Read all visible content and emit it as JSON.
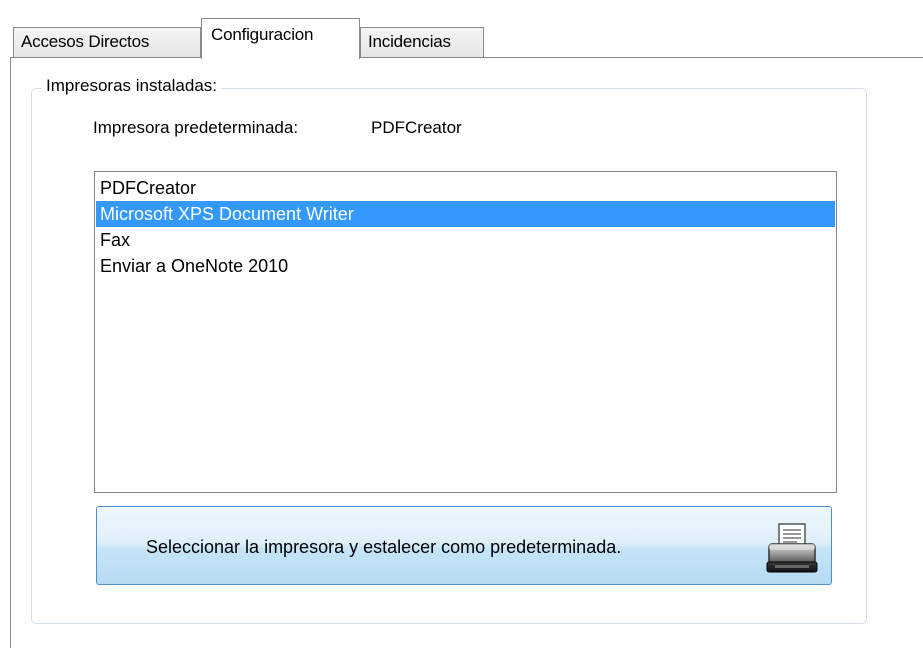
{
  "tabs": [
    {
      "label": "Accesos Directos",
      "active": false
    },
    {
      "label": "Configuracion",
      "active": true
    },
    {
      "label": "Incidencias",
      "active": false
    }
  ],
  "group": {
    "title": "Impresoras instaladas:",
    "default_label": "Impresora predeterminada:",
    "default_value": "PDFCreator"
  },
  "printers": {
    "items": [
      {
        "label": "PDFCreator",
        "selected": false
      },
      {
        "label": "Microsoft XPS Document Writer",
        "selected": true
      },
      {
        "label": "Fax",
        "selected": false
      },
      {
        "label": "Enviar a OneNote 2010",
        "selected": false
      }
    ]
  },
  "set_default_button": {
    "label": "Seleccionar la impresora y estalecer como predeterminada.",
    "icon": "printer-icon"
  },
  "colors": {
    "selection": "#3399ff",
    "button_border": "#4f8fc9",
    "groupbox_border": "#d5dfe5"
  }
}
